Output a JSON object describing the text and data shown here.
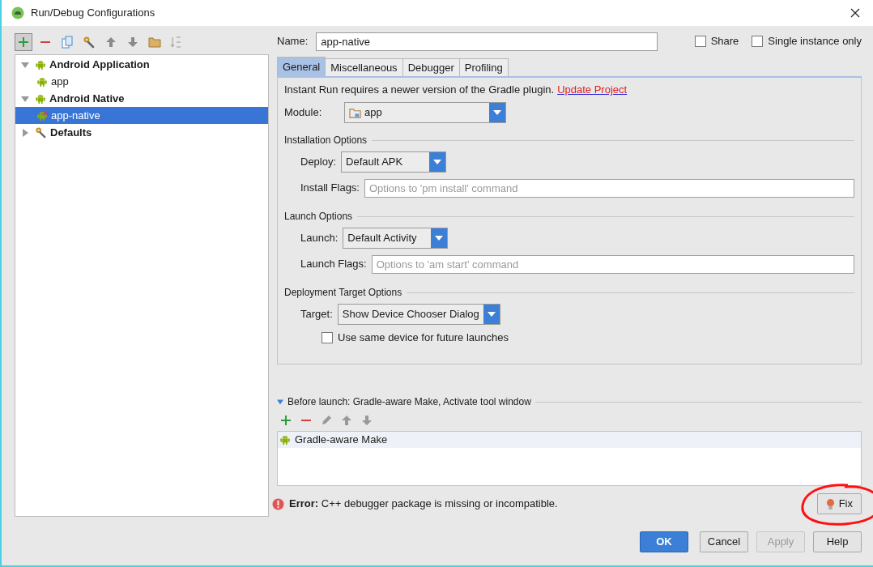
{
  "window": {
    "title": "Run/Debug Configurations"
  },
  "toolbar": {
    "buttons": [
      {
        "kind": "add",
        "selected": true
      },
      {
        "kind": "remove",
        "selected": false
      },
      {
        "kind": "copy",
        "selected": false
      },
      {
        "kind": "wrench",
        "selected": false
      },
      {
        "kind": "up",
        "selected": false
      },
      {
        "kind": "down",
        "selected": false
      },
      {
        "kind": "folder",
        "selected": false
      },
      {
        "kind": "sort",
        "selected": false
      }
    ]
  },
  "tree": [
    {
      "label": "Android Application",
      "kind": "android",
      "expanded": true,
      "selected": false,
      "children": [
        {
          "label": "app",
          "kind": "android",
          "selected": false,
          "error": false
        }
      ]
    },
    {
      "label": "Android Native",
      "kind": "android",
      "expanded": true,
      "selected": false,
      "children": [
        {
          "label": "app-native",
          "kind": "android",
          "selected": true,
          "error": true
        }
      ]
    },
    {
      "label": "Defaults",
      "kind": "wrench",
      "expanded": false,
      "selected": false
    }
  ],
  "name": {
    "label": "Name:",
    "value": "app-native"
  },
  "options": [
    {
      "label": "Share",
      "checked": false
    },
    {
      "label": "Single instance only",
      "checked": false
    }
  ],
  "tabs": [
    {
      "label": "General",
      "selected": true
    },
    {
      "label": "Miscellaneous",
      "selected": false
    },
    {
      "label": "Debugger",
      "selected": false
    },
    {
      "label": "Profiling",
      "selected": false
    }
  ],
  "notice": {
    "text": "Instant Run requires a newer version of the Gradle plugin.",
    "link": "Update Project"
  },
  "module": {
    "label": "Module:",
    "value": "app"
  },
  "sections": [
    {
      "title": "Installation Options",
      "rows": [
        {
          "kind": "dropdown",
          "label": "Deploy:",
          "value": "Default APK"
        },
        {
          "kind": "text",
          "label": "Install Flags:",
          "placeholder": "Options to 'pm install' command"
        }
      ]
    },
    {
      "title": "Launch Options",
      "rows": [
        {
          "kind": "dropdown",
          "label": "Launch:",
          "value": "Default Activity"
        },
        {
          "kind": "text",
          "label": "Launch Flags:",
          "placeholder": "Options to 'am start' command"
        }
      ]
    },
    {
      "title": "Deployment Target Options",
      "rows": [
        {
          "kind": "dropdown",
          "label": "Target:",
          "value": "Show Device Chooser Dialog"
        },
        {
          "kind": "checkbox",
          "label": "Use same device for future launches",
          "checked": false
        }
      ]
    }
  ],
  "before_launch": {
    "title": "Before launch: Gradle-aware Make, Activate tool window",
    "expanded": true,
    "tools": [
      {
        "kind": "add"
      },
      {
        "kind": "remove"
      },
      {
        "kind": "edit"
      },
      {
        "kind": "up"
      },
      {
        "kind": "down"
      }
    ],
    "items": [
      {
        "label": "Gradle-aware Make",
        "selected": true
      }
    ]
  },
  "error": {
    "label": "Error:",
    "text": "C++ debugger package is missing or incompatible.",
    "fix": "Fix"
  },
  "buttons": [
    {
      "label": "OK",
      "kind": "default",
      "disabled": false
    },
    {
      "label": "Cancel",
      "kind": "normal",
      "disabled": false
    },
    {
      "label": "Apply",
      "kind": "normal",
      "disabled": true
    },
    {
      "label": "Help",
      "kind": "normal",
      "disabled": false
    }
  ]
}
